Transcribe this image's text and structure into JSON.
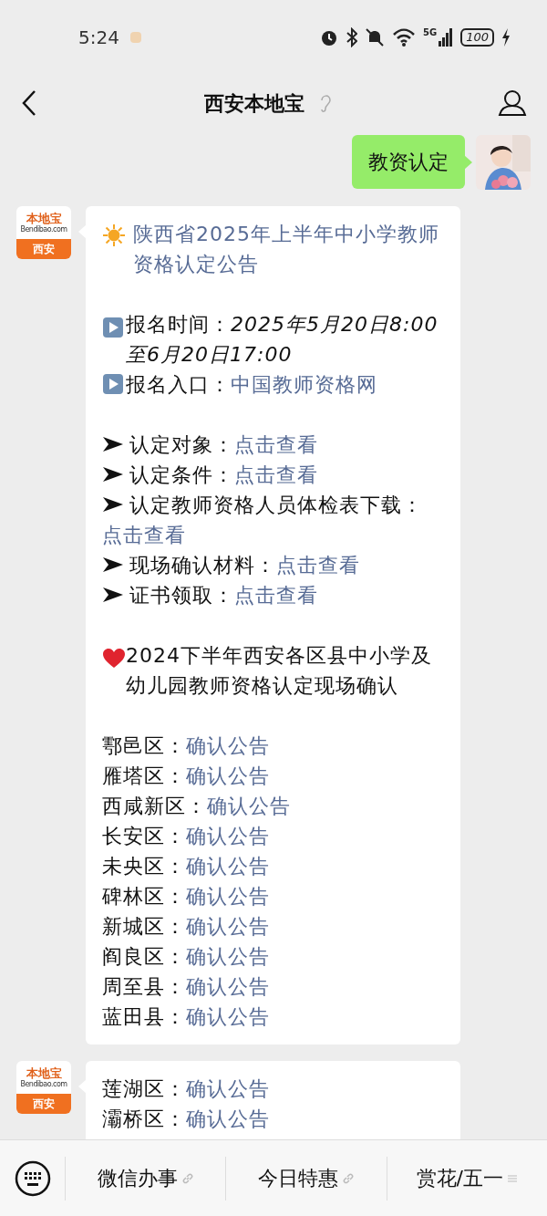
{
  "status_bar": {
    "time": "5:24",
    "network": "5G",
    "battery": "100"
  },
  "header": {
    "title": "西安本地宝"
  },
  "messages": [
    {
      "kind": "outgoing",
      "text": "教资认定"
    },
    {
      "kind": "incoming",
      "logo": {
        "brand": "本地宝",
        "site": "Bendibao.com",
        "city": "西安"
      },
      "sections": [
        [
          {
            "kind": "title",
            "text": "陕西省2025年上半年中小学教师资格认定公告"
          }
        ],
        [
          {
            "kind": "play",
            "label": "报名时间：",
            "value": "2025年5月20日8:00至6月20日17:00"
          },
          {
            "kind": "play",
            "label": "报名入口：",
            "link": "中国教师资格网"
          }
        ],
        [
          {
            "kind": "arrow",
            "label": "认定对象：",
            "link": "点击查看"
          },
          {
            "kind": "arrow",
            "label": "认定条件：",
            "link": "点击查看"
          },
          {
            "kind": "arrow",
            "label": "认定教师资格人员体检表下载：",
            "link": "点击查看"
          },
          {
            "kind": "arrow",
            "label": "现场确认材料：",
            "link": "点击查看"
          },
          {
            "kind": "arrow",
            "label": "证书领取：",
            "link": "点击查看"
          }
        ],
        [
          {
            "kind": "heart",
            "text": "2024下半年西安各区县中小学及幼儿园教师资格认定现场确认"
          }
        ],
        [
          {
            "kind": "plain",
            "label": "鄠邑区：",
            "link": "确认公告"
          },
          {
            "kind": "plain",
            "label": "雁塔区：",
            "link": "确认公告"
          },
          {
            "kind": "plain",
            "label": "西咸新区：",
            "link": "确认公告"
          },
          {
            "kind": "plain",
            "label": "长安区：",
            "link": "确认公告"
          },
          {
            "kind": "plain",
            "label": "未央区：",
            "link": "确认公告"
          },
          {
            "kind": "plain",
            "label": "碑林区：",
            "link": "确认公告"
          },
          {
            "kind": "plain",
            "label": "新城区：",
            "link": "确认公告"
          },
          {
            "kind": "plain",
            "label": "阎良区：",
            "link": "确认公告"
          },
          {
            "kind": "plain",
            "label": "周至县：",
            "link": "确认公告"
          },
          {
            "kind": "plain",
            "label": "蓝田县：",
            "link": "确认公告"
          }
        ]
      ]
    },
    {
      "kind": "incoming",
      "logo": {
        "brand": "本地宝",
        "site": "Bendibao.com",
        "city": "西安"
      },
      "sections": [
        [
          {
            "kind": "plain",
            "label": "莲湖区：",
            "link": "确认公告"
          },
          {
            "kind": "plain",
            "label": "灞桥区：",
            "link": "确认公告"
          }
        ]
      ]
    }
  ],
  "bottom_menu": [
    {
      "kind": "link",
      "label": "微信办事"
    },
    {
      "kind": "link",
      "label": "今日特惠"
    },
    {
      "kind": "menu",
      "label": "赏花/五一"
    }
  ]
}
